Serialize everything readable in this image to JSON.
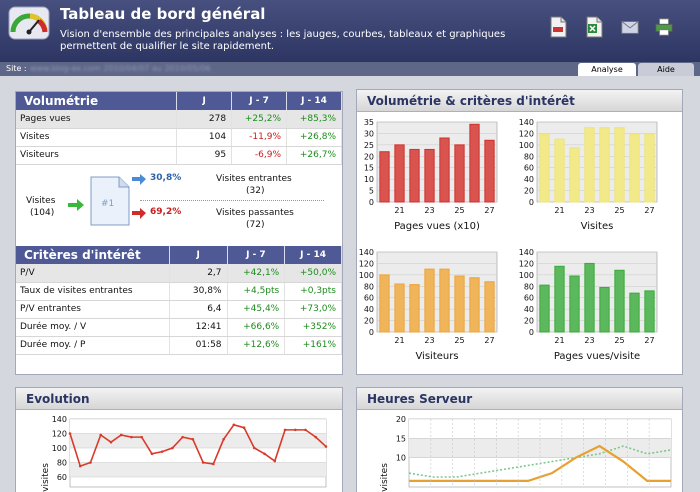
{
  "header": {
    "title": "Tableau de bord général",
    "description": "Vision d'ensemble des principales analyses : les jauges, courbes, tableaux et graphiques permettent de qualifier le site rapidement.",
    "toolbar_icons": [
      "pdf-icon",
      "excel-icon",
      "email-icon",
      "print-icon"
    ]
  },
  "subbar": {
    "site_label": "Site :",
    "site_value": "www.blog-ex.com  2010/04/07 au 2010/05/06"
  },
  "tabs": [
    {
      "label": "Analyse",
      "active": true
    },
    {
      "label": "Aide",
      "active": false
    }
  ],
  "volumetrie": {
    "title": "Volumétrie",
    "columns": [
      "J",
      "J - 7",
      "J - 14"
    ],
    "rows": [
      {
        "label": "Pages vues",
        "j": "278",
        "j7": "+25,2%",
        "j14": "+85,3%"
      },
      {
        "label": "Visites",
        "j": "104",
        "j7": "-11,9%",
        "j14": "+26,8%"
      },
      {
        "label": "Visiteurs",
        "j": "95",
        "j7": "-6,9%",
        "j14": "+26,7%"
      }
    ]
  },
  "flow": {
    "visites_label": "Visites",
    "visites_count": "(104)",
    "page_label": "#1",
    "entrantes_pct": "30,8%",
    "entrantes_label": "Visites entrantes",
    "entrantes_count": "(32)",
    "passantes_pct": "69,2%",
    "passantes_label": "Visites passantes",
    "passantes_count": "(72)"
  },
  "criteres": {
    "title": "Critères d'intérêt",
    "columns": [
      "J",
      "J - 7",
      "J - 14"
    ],
    "rows": [
      {
        "label": "P/V",
        "j": "2,7",
        "j7": "+42,1%",
        "j14": "+50,0%"
      },
      {
        "label": "Taux de visites entrantes",
        "j": "30,8%",
        "j7": "+4,5pts",
        "j14": "+0,3pts"
      },
      {
        "label": "P/V entrantes",
        "j": "6,4",
        "j7": "+45,4%",
        "j14": "+73,0%"
      },
      {
        "label": "Durée moy. / V",
        "j": "12:41",
        "j7": "+66,6%",
        "j14": "+352%"
      },
      {
        "label": "Durée moy. / P",
        "j": "01:58",
        "j7": "+12,6%",
        "j14": "+161%"
      }
    ]
  },
  "volcrit": {
    "title": "Volumétrie & critères d'intérêt"
  },
  "evolution": {
    "title": "Evolution"
  },
  "heures": {
    "title": "Heures Serveur"
  },
  "colors": {
    "header": "#2d3563",
    "table_header": "#4e5995",
    "positive": "#1c8c1c",
    "negative": "#d01818"
  },
  "chart_data": [
    {
      "type": "bar",
      "xlabel": "Pages vues (x10)",
      "ylim": [
        0,
        35
      ],
      "yticks": [
        0,
        5,
        10,
        15,
        20,
        25,
        30,
        35
      ],
      "x": [
        20,
        21,
        22,
        23,
        24,
        25,
        26,
        27
      ],
      "xticks": [
        21,
        23,
        25,
        27
      ],
      "values": [
        22,
        25,
        23,
        23,
        28,
        25,
        34,
        27
      ],
      "color": "#d9534f"
    },
    {
      "type": "bar",
      "xlabel": "Visites",
      "ylim": [
        0,
        140
      ],
      "yticks": [
        0,
        20,
        40,
        60,
        80,
        100,
        120,
        140
      ],
      "x": [
        20,
        21,
        22,
        23,
        24,
        25,
        26,
        27
      ],
      "xticks": [
        21,
        23,
        25,
        27
      ],
      "values": [
        118,
        110,
        95,
        130,
        130,
        130,
        118,
        118
      ],
      "color": "#f2e98a"
    },
    {
      "type": "bar",
      "xlabel": "Visiteurs",
      "ylim": [
        0,
        140
      ],
      "yticks": [
        0,
        20,
        40,
        60,
        80,
        100,
        120,
        140
      ],
      "x": [
        20,
        21,
        22,
        23,
        24,
        25,
        26,
        27
      ],
      "xticks": [
        21,
        23,
        25,
        27
      ],
      "values": [
        100,
        84,
        83,
        110,
        110,
        98,
        95,
        88
      ],
      "color": "#f0b45a"
    },
    {
      "type": "bar",
      "xlabel": "Pages vues/visite",
      "ylim": [
        0,
        140
      ],
      "yticks": [
        0,
        20,
        40,
        60,
        80,
        100,
        120,
        140
      ],
      "x": [
        20,
        21,
        22,
        23,
        24,
        25,
        26,
        27
      ],
      "xticks": [
        21,
        23,
        25,
        27
      ],
      "values": [
        82,
        115,
        98,
        120,
        78,
        108,
        68,
        72
      ],
      "color": "#5cb85c"
    },
    {
      "type": "line",
      "ylabel": "/visites",
      "ylim": [
        60,
        140
      ],
      "yticks": [
        60,
        80,
        100,
        120,
        140
      ],
      "values": [
        120,
        75,
        80,
        118,
        108,
        118,
        115,
        115,
        92,
        95,
        100,
        115,
        112,
        80,
        78,
        112,
        132,
        128,
        100,
        92,
        82,
        125,
        125,
        125,
        115,
        102
      ],
      "color": "#d93a2a"
    },
    {
      "type": "line",
      "ylabel": "/visites",
      "ylim": [
        5,
        20
      ],
      "yticks": [
        10,
        15,
        20
      ],
      "series": [
        {
          "values": [
            6,
            5,
            5,
            6,
            7,
            8,
            9,
            10,
            11,
            13,
            11,
            12
          ],
          "color": "#7bc88a"
        },
        {
          "values": [
            4,
            4,
            4,
            4,
            4,
            4,
            6,
            10,
            13,
            9,
            4,
            4
          ],
          "color": "#e8a030"
        }
      ]
    }
  ]
}
